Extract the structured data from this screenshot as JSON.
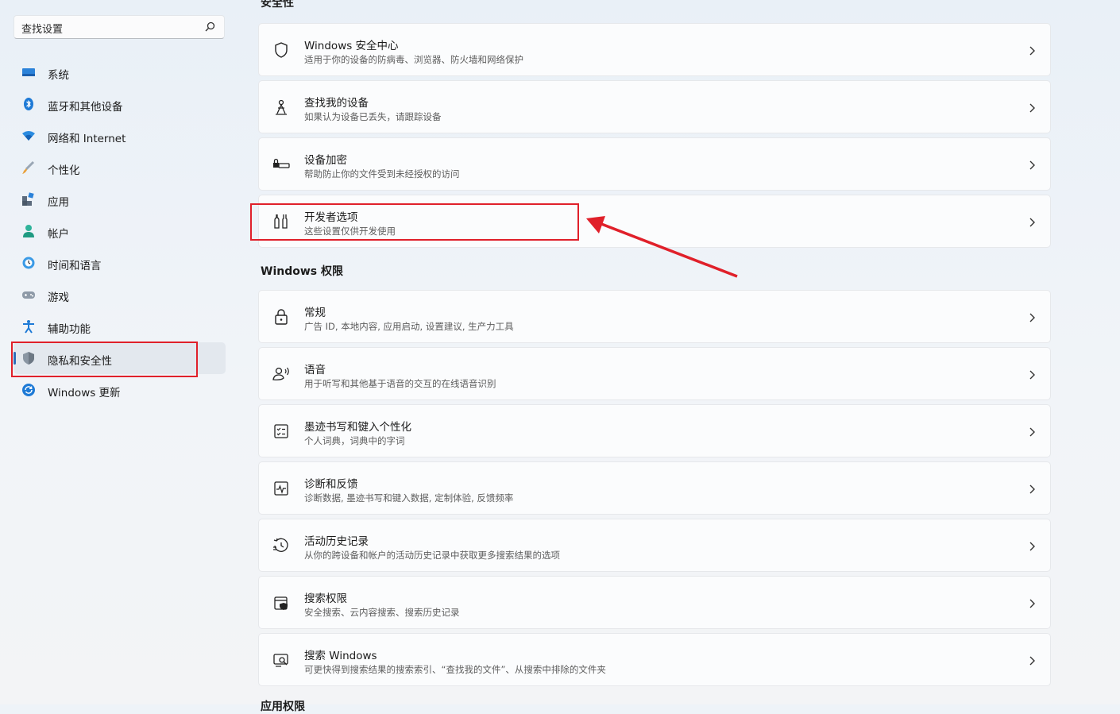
{
  "search": {
    "placeholder": "查找设置"
  },
  "sidebar": {
    "items": [
      {
        "label": "系统",
        "icon": "system-icon"
      },
      {
        "label": "蓝牙和其他设备",
        "icon": "bluetooth-icon"
      },
      {
        "label": "网络和 Internet",
        "icon": "wifi-icon"
      },
      {
        "label": "个性化",
        "icon": "brush-icon"
      },
      {
        "label": "应用",
        "icon": "apps-icon"
      },
      {
        "label": "帐户",
        "icon": "account-icon"
      },
      {
        "label": "时间和语言",
        "icon": "clock-globe-icon"
      },
      {
        "label": "游戏",
        "icon": "gamepad-icon"
      },
      {
        "label": "辅助功能",
        "icon": "accessibility-icon"
      },
      {
        "label": "隐私和安全性",
        "icon": "shield-icon",
        "active": true
      },
      {
        "label": "Windows 更新",
        "icon": "update-icon"
      }
    ]
  },
  "sections": [
    {
      "title": "安全性"
    },
    {
      "title": "Windows 权限"
    },
    {
      "title": "应用权限"
    }
  ],
  "security_cards": [
    {
      "title": "Windows 安全中心",
      "subtitle": "适用于你的设备的防病毒、浏览器、防火墙和网络保护",
      "icon": "shield-outline-icon"
    },
    {
      "title": "查找我的设备",
      "subtitle": "如果认为设备已丢失，请跟踪设备",
      "icon": "person-locate-icon"
    },
    {
      "title": "设备加密",
      "subtitle": "帮助防止你的文件受到未经授权的访问",
      "icon": "drive-lock-icon"
    },
    {
      "title": "开发者选项",
      "subtitle": "这些设置仅供开发使用",
      "icon": "developer-tools-icon"
    }
  ],
  "permission_cards": [
    {
      "title": "常规",
      "subtitle": "广告 ID, 本地内容, 应用启动, 设置建议, 生产力工具",
      "icon": "lock-icon"
    },
    {
      "title": "语音",
      "subtitle": "用于听写和其他基于语音的交互的在线语音识别",
      "icon": "speech-icon"
    },
    {
      "title": "墨迹书写和键入个性化",
      "subtitle": "个人词典，词典中的字词",
      "icon": "checklist-icon"
    },
    {
      "title": "诊断和反馈",
      "subtitle": "诊断数据, 墨迹书写和键入数据, 定制体验, 反馈频率",
      "icon": "diagnostics-icon"
    },
    {
      "title": "活动历史记录",
      "subtitle": "从你的跨设备和帐户的活动历史记录中获取更多搜索结果的选项",
      "icon": "history-icon"
    },
    {
      "title": "搜索权限",
      "subtitle": "安全搜索、云内容搜索、搜索历史记录",
      "icon": "search-permission-icon"
    },
    {
      "title": "搜索 Windows",
      "subtitle": "可更快得到搜索结果的搜索索引、“查找我的文件”、从搜索中排除的文件夹",
      "icon": "search-windows-icon"
    }
  ],
  "colors": {
    "accent": "#2f6db8",
    "annotation": "#e0202a"
  }
}
